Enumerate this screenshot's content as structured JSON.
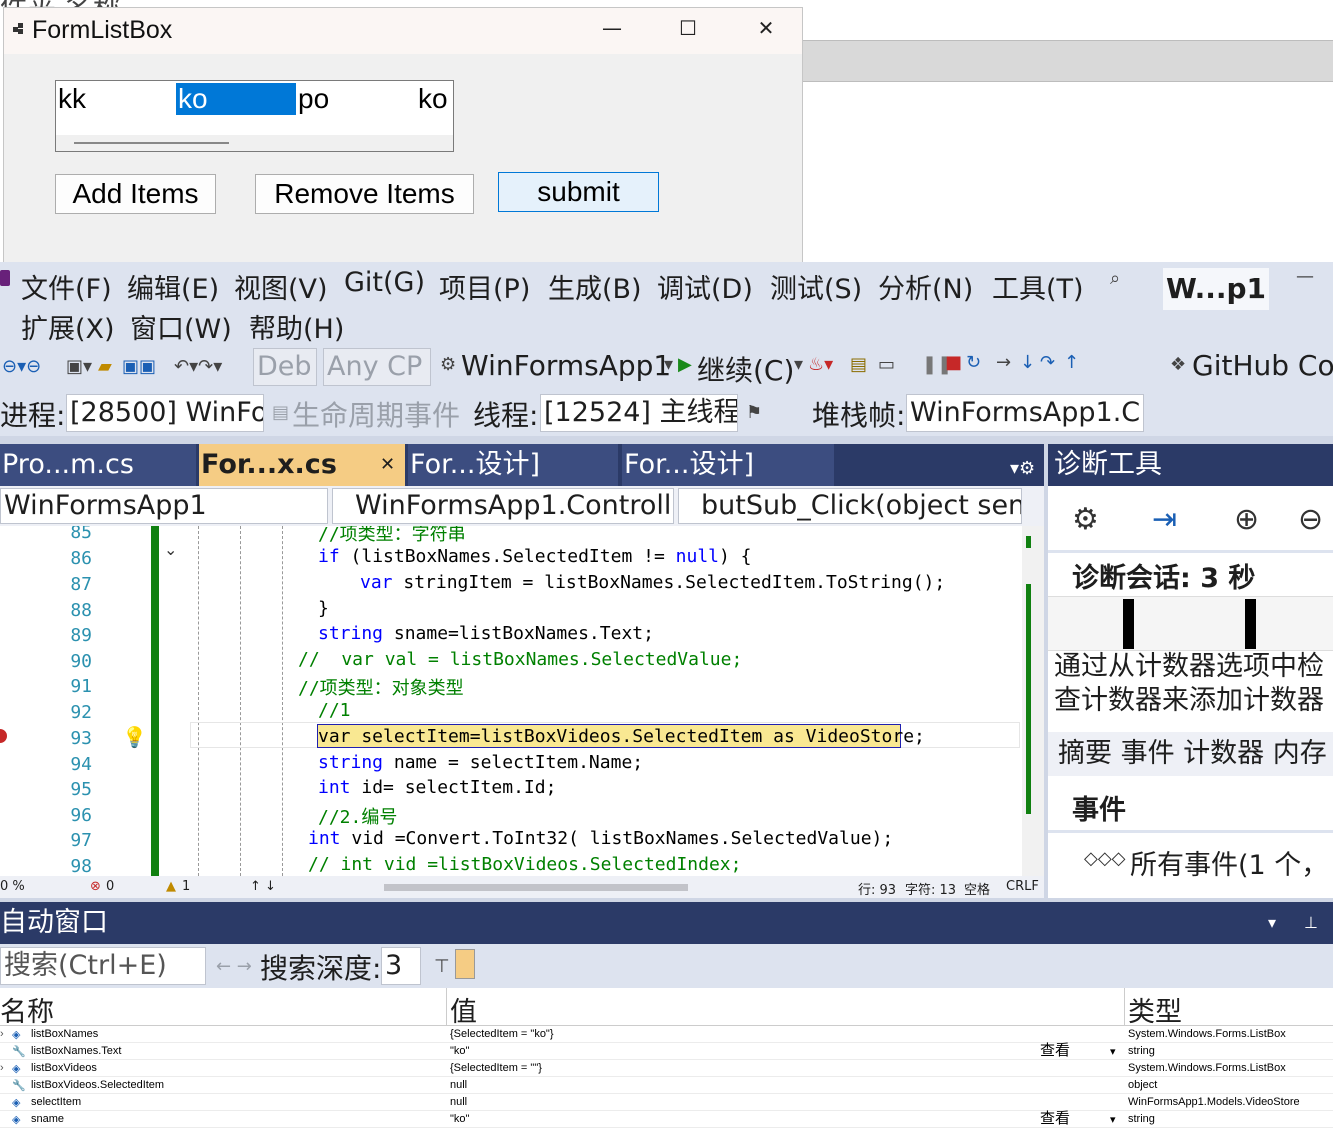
{
  "background": {
    "title_fragment": "件夹    名称"
  },
  "form": {
    "title": "FormListBox",
    "minimize": "—",
    "maximize": "☐",
    "close": "✕",
    "list_items": [
      "kk",
      "ko",
      "po",
      "ko"
    ],
    "selected_item": "ko",
    "buttons": {
      "add": "Add Items",
      "remove": "Remove Items",
      "submit": "submit"
    }
  },
  "menu": [
    "文件(F)",
    "编辑(E)",
    "视图(V)",
    "Git(G)",
    "项目(P)",
    "生成(B)",
    "调试(D)",
    "测试(S)",
    "分析(N)",
    "工具(T)",
    "扩展(X)",
    "窗口(W)",
    "帮助(H)"
  ],
  "window_title": "W...p1",
  "toolbar": {
    "config": "Deb",
    "platform": "Any CP",
    "project": "WinFormsApp1",
    "continue": "继续(C)",
    "github": "GitHub Cop"
  },
  "debug_bar": {
    "process_label": "进程:",
    "process_value": "[28500] WinFo",
    "lifecycle": "生命周期事件",
    "thread_label": "线程:",
    "thread_value": "[12524] 主线程",
    "stack_label": "堆栈帧:",
    "stack_value": "WinFormsApp1.C"
  },
  "doc_tabs": [
    {
      "label": "Pro...m.cs",
      "state": "inactive"
    },
    {
      "label": "For...x.cs",
      "state": "active"
    },
    {
      "label": "For...设计]",
      "state": "inactive"
    },
    {
      "label": "For...设计]",
      "state": "inactive"
    }
  ],
  "nav": {
    "project": "WinFormsApp1",
    "class": "WinFormsApp1.Controll",
    "member": "butSub_Click(object sen"
  },
  "code": {
    "lines": [
      85,
      86,
      87,
      88,
      89,
      90,
      91,
      92,
      93,
      94,
      95,
      96,
      97,
      98
    ],
    "current_line": 93,
    "l85": "//项类型：字符串",
    "l86a": "if",
    "l86b": " (listBoxNames.SelectedItem != ",
    "l86c": "null",
    "l86d": ") {",
    "l87a": "var",
    "l87b": " stringItem = listBoxNames.SelectedItem.ToString();",
    "l88": "}",
    "l89a": "string",
    "l89b": " sname=listBoxNames.Text;",
    "l90": "//  var val = listBoxNames.SelectedValue;",
    "l91": "//项类型：对象类型",
    "l92": "//1",
    "l93": "var selectItem=listBoxVideos.SelectedItem as VideoStore;",
    "l94a": "string",
    "l94b": " name = selectItem.Name;",
    "l95a": "int",
    "l95b": " id= selectItem.Id;",
    "l96": "//2.编号",
    "l97a": "int",
    "l97b": " vid =Convert.ToInt32( listBoxNames.SelectedValue);",
    "l98": "// int vid =listBoxVideos.SelectedIndex;"
  },
  "status": {
    "zoom": "0 %",
    "errors": "0",
    "warnings": "1",
    "line": "行: 93",
    "col": "字符: 13",
    "space": "空格",
    "eol": "CRLF"
  },
  "diagnostics": {
    "title": "诊断工具",
    "session": "诊断会话: 3 秒",
    "hint": "通过从计数器选项中检查计数器来添加计数器图",
    "tabs": "摘要  事件  计数器  内存",
    "events_header": "事件",
    "all_events": "所有事件(1 个，"
  },
  "autos": {
    "title": "自动窗口",
    "search_placeholder": "搜索(Ctrl+E)",
    "depth_label": "搜索深度:",
    "depth_value": "3",
    "columns": {
      "name": "名称",
      "value": "值",
      "type": "类型"
    },
    "rows": [
      {
        "name": "listBoxNames",
        "value": "{SelectedItem = \"ko\"}",
        "type": "System.Windows.Forms.ListBox",
        "view": ""
      },
      {
        "name": "listBoxNames.Text",
        "value": "\"ko\"",
        "type": "string",
        "view": "查看"
      },
      {
        "name": "listBoxVideos",
        "value": "{SelectedItem = \"\"}",
        "type": "System.Windows.Forms.ListBox",
        "view": ""
      },
      {
        "name": "listBoxVideos.SelectedItem",
        "value": "null",
        "type": "object",
        "view": ""
      },
      {
        "name": "selectItem",
        "value": "null",
        "type": "WinFormsApp1.Models.VideoStore",
        "view": ""
      },
      {
        "name": "sname",
        "value": "\"ko\"",
        "type": "string",
        "view": "查看"
      }
    ]
  }
}
